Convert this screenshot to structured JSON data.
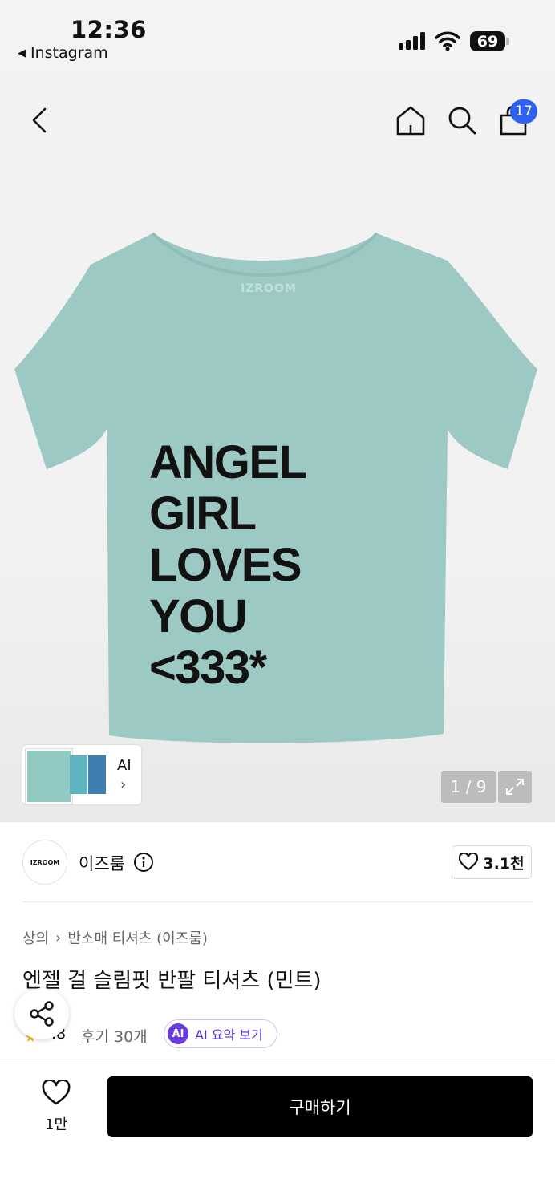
{
  "status_bar": {
    "time": "12:36",
    "back_app": "Instagram",
    "battery": "69"
  },
  "header": {
    "icons": [
      "back-icon",
      "home-icon",
      "search-icon",
      "cart-icon"
    ],
    "cart_count": "17"
  },
  "product_image": {
    "brand_print": "IZROOM",
    "print_lines": [
      "ANGEL",
      "GIRL",
      "LOVES",
      "YOU",
      "<333*"
    ],
    "tee_color": "#9dc9c5",
    "thumbnail_label": "AI",
    "pager": "1 / 9"
  },
  "store": {
    "logo_text": "IZROOM",
    "name": "이즈룸",
    "like_count": "3.1천"
  },
  "breadcrumb": [
    "상의",
    "반소매 티셔츠 (이즈룸)"
  ],
  "title": "엔젤 걸 슬림핏 반팔 티셔츠 (민트)",
  "rating": {
    "value": ".8",
    "reviews": "후기 30개",
    "ai_badge": "AI",
    "ai_summary": "AI 요약 보기"
  },
  "bottom_bar": {
    "wish_count": "1만",
    "buy_label": "구매하기"
  },
  "colors": {
    "accent_badge": "#2c61f2",
    "ai_purple": "#6a3ce0",
    "buy_button": "#000000"
  }
}
